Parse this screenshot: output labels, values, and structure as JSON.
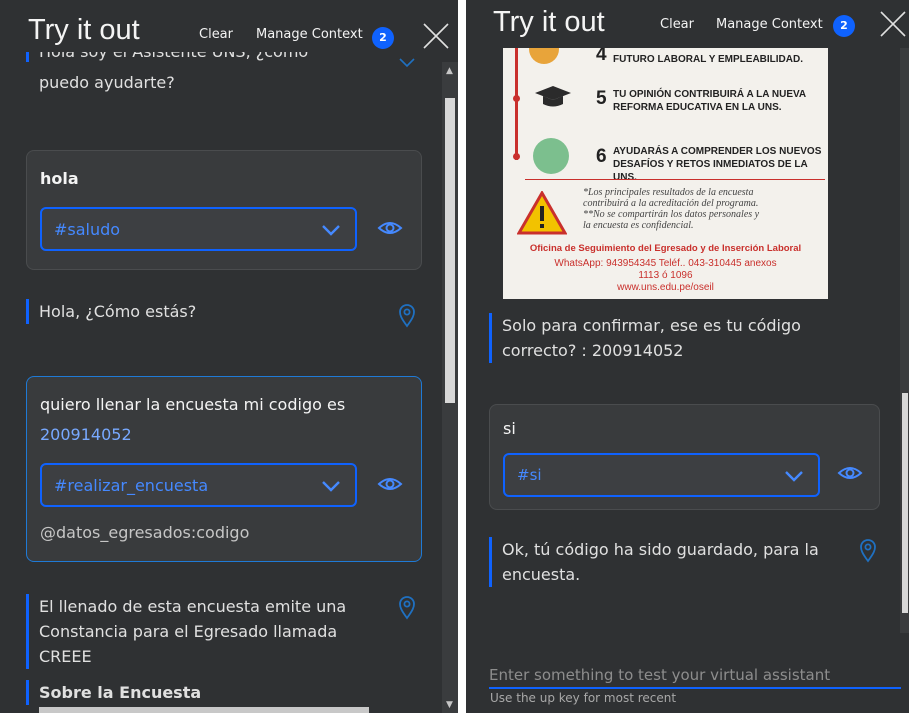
{
  "header": {
    "title": "Try it out",
    "clear_label": "Clear",
    "manage_context_label": "Manage Context",
    "context_count": "2"
  },
  "left": {
    "partial_top_line": "Hola soy el Asistente UNS, ¿cómo",
    "greeting_line2": "puedo ayudarte?",
    "user1": {
      "text": "hola",
      "intent": "#saludo"
    },
    "bot1": "Hola, ¿Cómo estás?",
    "user2": {
      "text_line1": "quiero llenar la encuesta mi codigo es",
      "text_line2": "200914052",
      "intent": "#realizar_encuesta",
      "entity": "@datos_egresados:codigo"
    },
    "bot2_line1": "El llenado de esta encuesta emite una",
    "bot2_line2": "Constancia para el Egresado llamada",
    "bot2_line3": "CREEE",
    "bot3": "Sobre la Encuesta"
  },
  "right": {
    "image": {
      "item4": "FUTURO LABORAL Y EMPLEABILIDAD.",
      "item5_num": "5",
      "item5_l1": "TU OPINIÓN CONTRIBUIRÁ A LA NUEVA",
      "item5_l2": "REFORMA EDUCATIVA EN LA UNS.",
      "item6_num": "6",
      "item6_l1": "AYUDARÁS A COMPRENDER LOS NUEVOS",
      "item6_l2": "DESAFÍOS Y RETOS INMEDIATOS DE LA UNS.",
      "note_l1": "*Los principales resultados de la encuesta",
      "note_l2": "contribuirá a la acreditación del programa.",
      "note_l3": "**No se compartirán los datos personales y",
      "note_l4": "la encuesta es confidencial.",
      "office": "Oficina de Seguimiento del Egresado y de Inserción Laboral",
      "contact": "WhatsApp: 943954345 Teléf.. 043-310445 anexos",
      "ext": "1113 ó 1096",
      "web": "www.uns.edu.pe/oseil"
    },
    "bot1_line1": "Solo para confirmar, ese es tu código",
    "bot1_line2": "correcto? : 200914052",
    "user1": {
      "text": "si",
      "intent": "#si"
    },
    "bot2_line1": "Ok, tú código ha sido guardado, para la",
    "bot2_line2": "encuesta.",
    "input_placeholder": "Enter something to test your virtual assistant",
    "input_hint": "Use the up key for most recent"
  },
  "colors": {
    "accent": "#0f62fe",
    "panel_bg": "#2f3133",
    "intent_text": "#4589ff",
    "poster_red": "#c9302c"
  },
  "icons": [
    "close-icon",
    "chevron-down-icon",
    "eye-icon",
    "location-pin-icon",
    "warning-icon",
    "graduation-cap-icon"
  ]
}
